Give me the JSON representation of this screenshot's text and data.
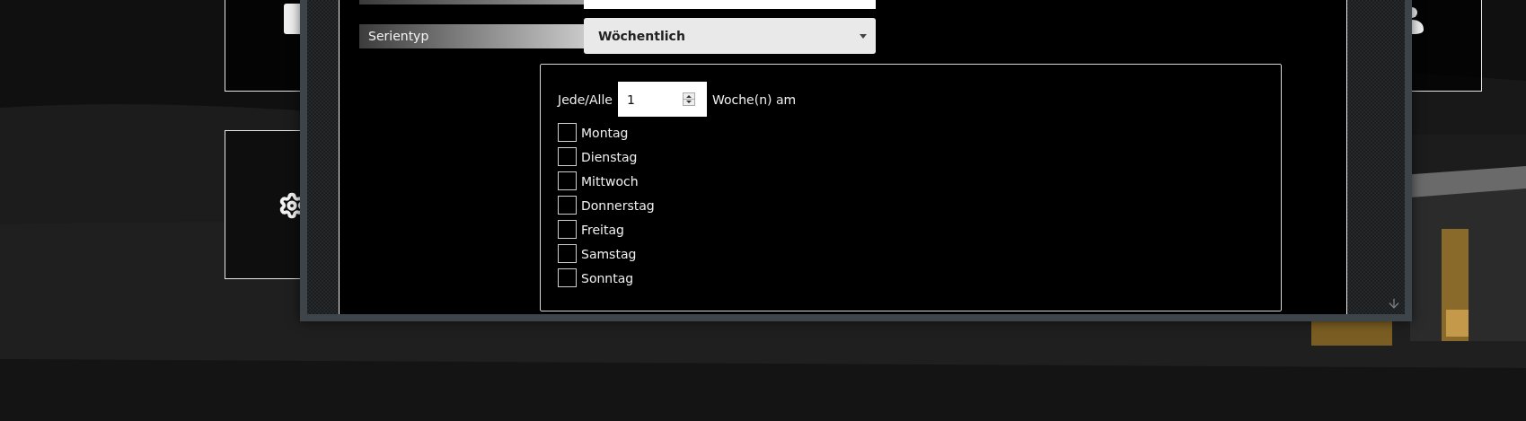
{
  "dialog": {
    "series_type": {
      "label": "Serientyp",
      "value": "Wöchentlich"
    },
    "recurrence": {
      "prefix": "Jede/Alle",
      "interval": "1",
      "suffix": "Woche(n) am",
      "days": [
        {
          "label": "Montag",
          "checked": false
        },
        {
          "label": "Dienstag",
          "checked": false
        },
        {
          "label": "Mittwoch",
          "checked": false
        },
        {
          "label": "Donnerstag",
          "checked": false
        },
        {
          "label": "Freitag",
          "checked": false
        },
        {
          "label": "Samstag",
          "checked": false
        },
        {
          "label": "Sonntag",
          "checked": false
        }
      ]
    }
  }
}
